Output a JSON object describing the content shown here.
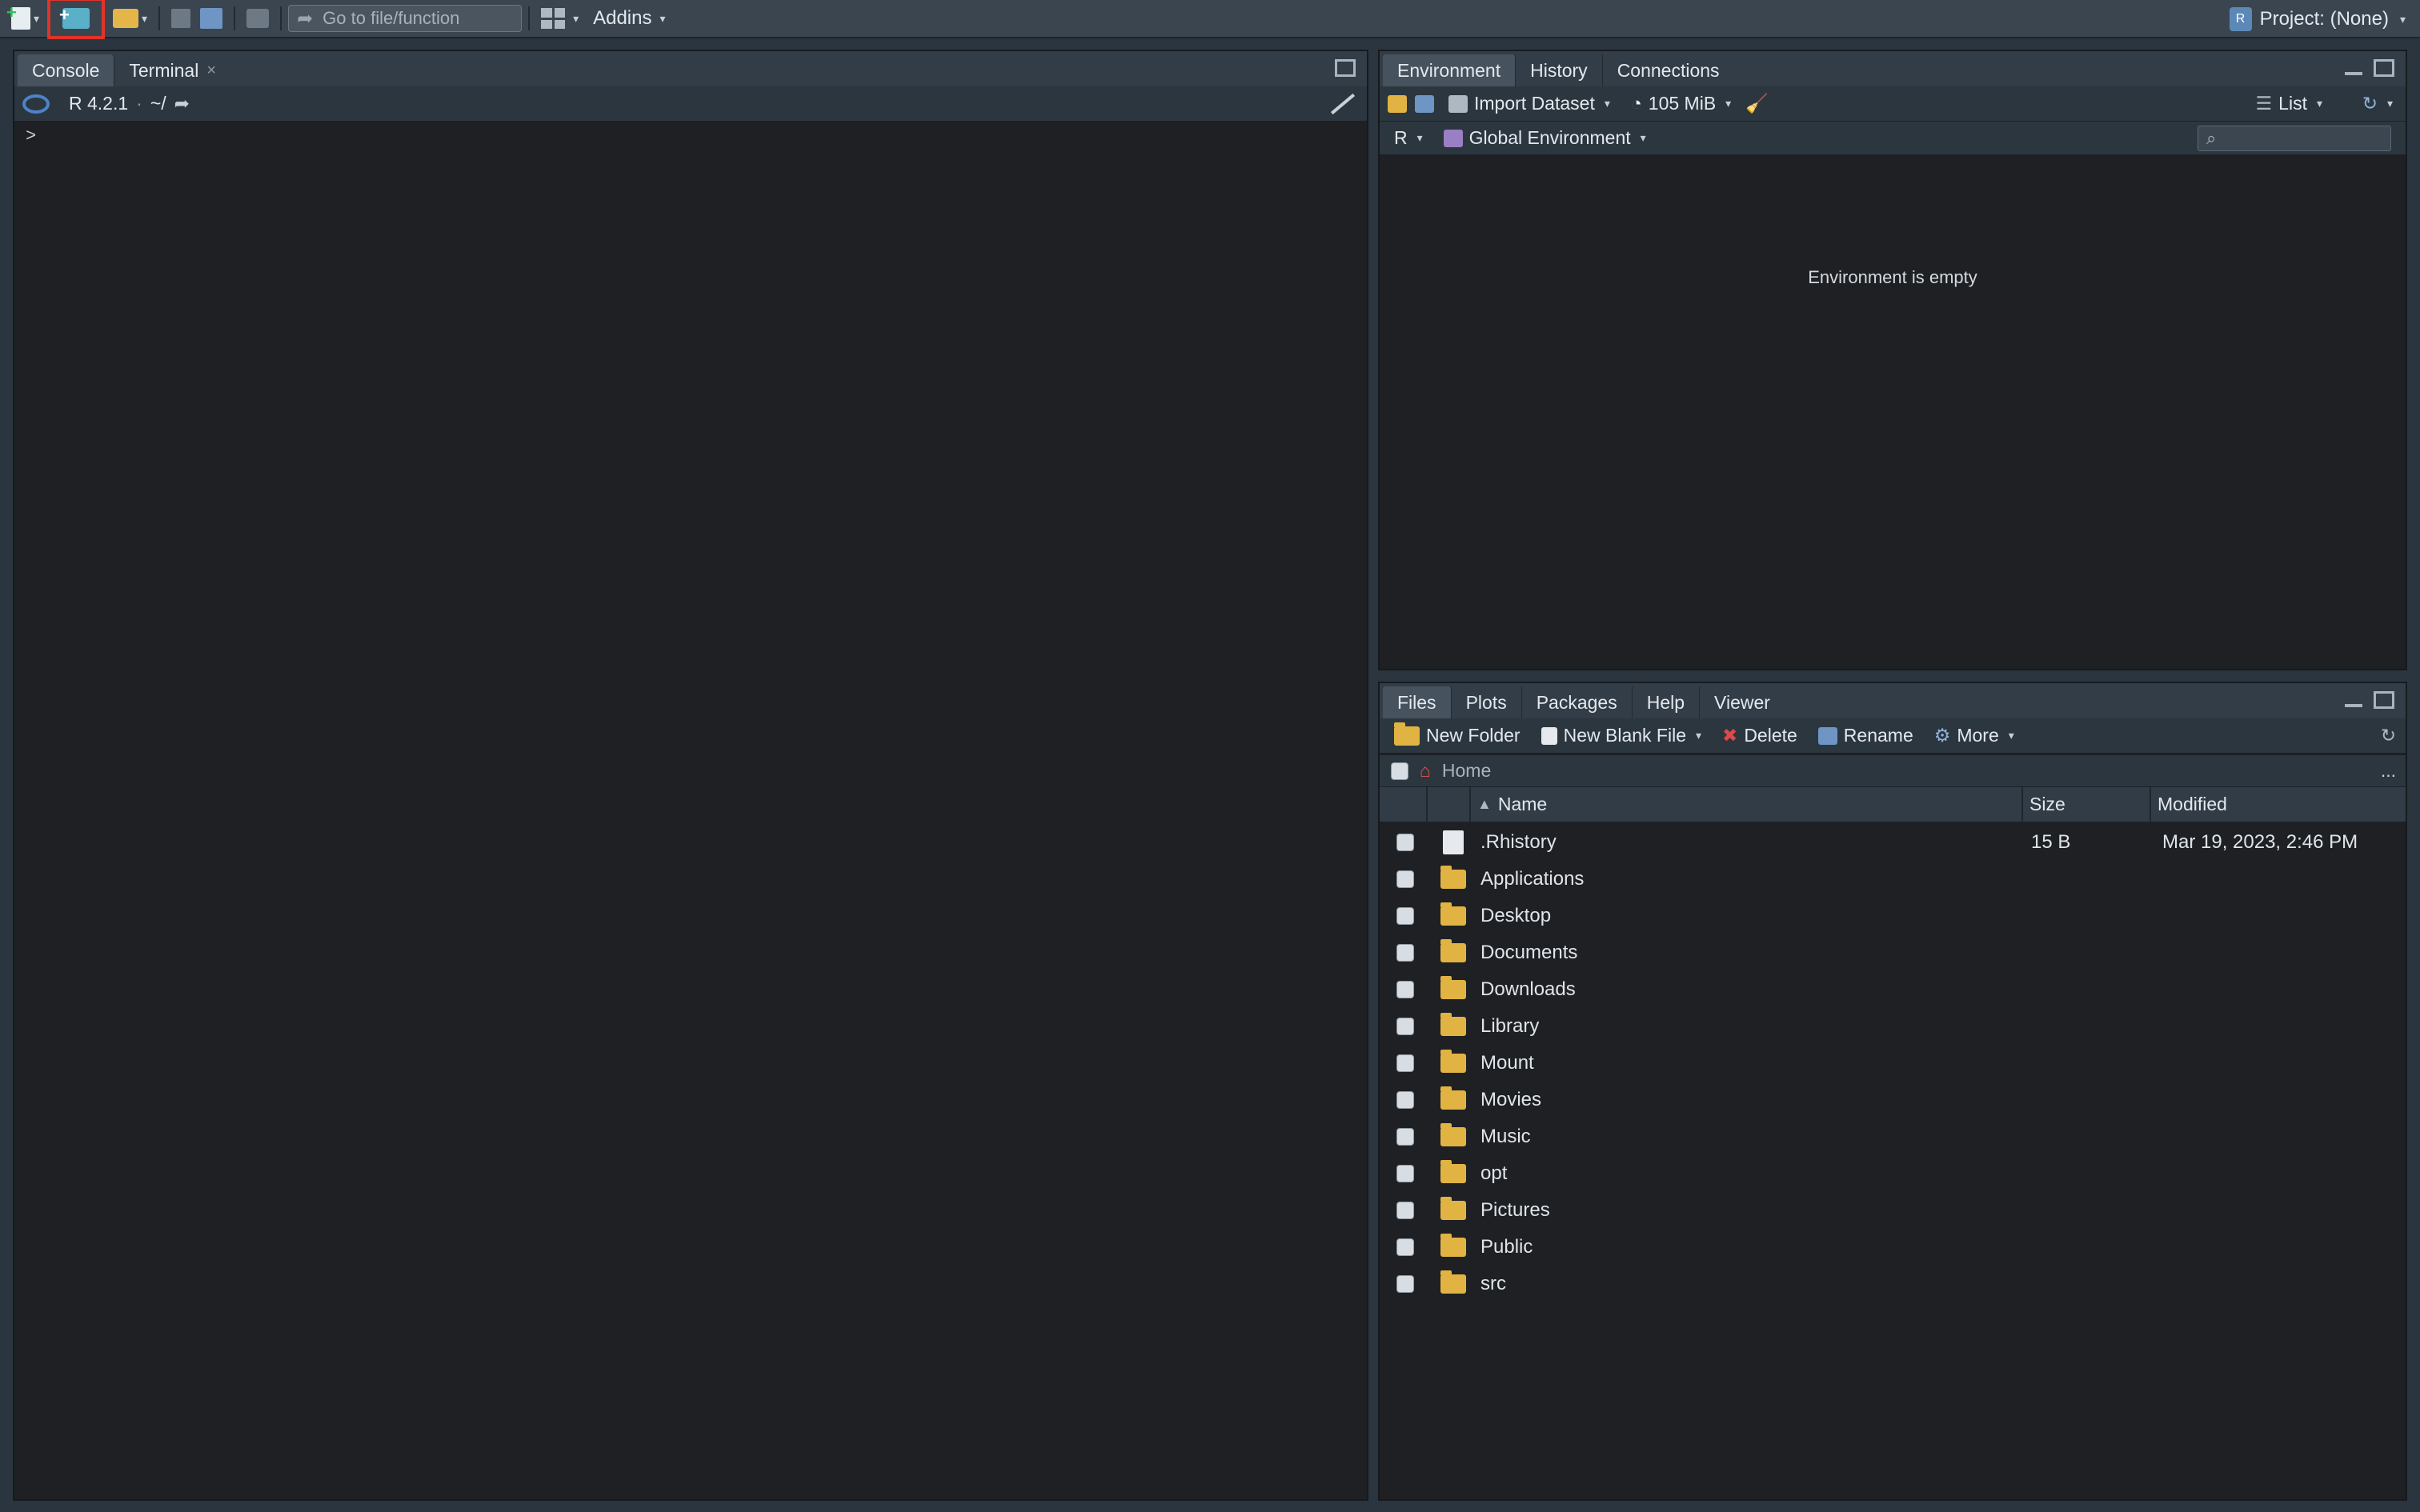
{
  "toolbar": {
    "goto_placeholder": "Go to file/function",
    "addins_label": "Addins",
    "project_label": "Project: (None)",
    "icons": [
      "new-file-icon",
      "new-project-icon",
      "open-folder-icon",
      "save-icon",
      "save-all-icon",
      "print-icon",
      "go-to-arrow-icon",
      "pane-layout-icon",
      "r-project-icon"
    ],
    "highlight_color": "#e0342a"
  },
  "console_pane": {
    "tabs": [
      {
        "label": "Console"
      },
      {
        "label": "Terminal",
        "close": "×"
      }
    ],
    "r_version": "R 4.2.1",
    "sep": "·",
    "working_dir": "~/",
    "prompt": ">"
  },
  "env_pane": {
    "tabs": [
      {
        "label": "Environment"
      },
      {
        "label": "History"
      },
      {
        "label": "Connections"
      }
    ],
    "import_label": "Import Dataset",
    "memory_label": "105 MiB",
    "view_mode": "List",
    "language": "R",
    "scope": "Global Environment",
    "empty_message": "Environment is empty"
  },
  "files_pane": {
    "tabs": [
      {
        "label": "Files"
      },
      {
        "label": "Plots"
      },
      {
        "label": "Packages"
      },
      {
        "label": "Help"
      },
      {
        "label": "Viewer"
      }
    ],
    "actions": {
      "new_folder": "New Folder",
      "new_blank_file": "New Blank File",
      "delete": "Delete",
      "rename": "Rename",
      "more": "More"
    },
    "path": "Home",
    "more_path": "...",
    "columns": {
      "name": "Name",
      "size": "Size",
      "modified": "Modified"
    },
    "rows": [
      {
        "name": ".Rhistory",
        "size": "15 B",
        "modified": "Mar 19, 2023, 2:46 PM",
        "type": "file"
      },
      {
        "name": "Applications",
        "size": "",
        "modified": "",
        "type": "folder"
      },
      {
        "name": "Desktop",
        "size": "",
        "modified": "",
        "type": "folder"
      },
      {
        "name": "Documents",
        "size": "",
        "modified": "",
        "type": "folder"
      },
      {
        "name": "Downloads",
        "size": "",
        "modified": "",
        "type": "folder"
      },
      {
        "name": "Library",
        "size": "",
        "modified": "",
        "type": "folder"
      },
      {
        "name": "Mount",
        "size": "",
        "modified": "",
        "type": "folder"
      },
      {
        "name": "Movies",
        "size": "",
        "modified": "",
        "type": "folder"
      },
      {
        "name": "Music",
        "size": "",
        "modified": "",
        "type": "folder"
      },
      {
        "name": "opt",
        "size": "",
        "modified": "",
        "type": "folder"
      },
      {
        "name": "Pictures",
        "size": "",
        "modified": "",
        "type": "folder"
      },
      {
        "name": "Public",
        "size": "",
        "modified": "",
        "type": "folder"
      },
      {
        "name": "src",
        "size": "",
        "modified": "",
        "type": "folder"
      }
    ]
  }
}
